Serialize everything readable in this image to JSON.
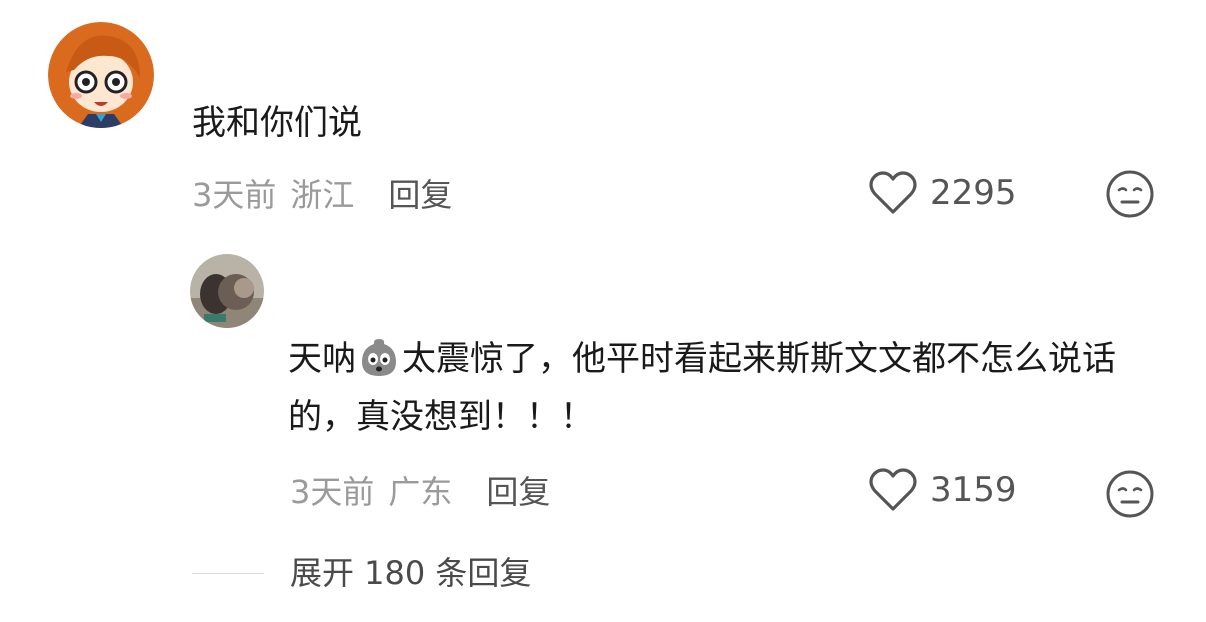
{
  "comments": [
    {
      "text": "我和你们说",
      "time": "3天前",
      "location": "浙江",
      "reply_label": "回复",
      "likes": "2295"
    },
    {
      "text_before_emoji": "天呐",
      "inline_emoji": "scared-face-emoji",
      "text_after_emoji": "太震惊了，他平时看起来斯斯文文都不怎么说话的，真没想到！！！",
      "time": "3天前",
      "location": "广东",
      "reply_label": "回复",
      "likes": "3159"
    }
  ],
  "expand_replies": "展开 180 条回复",
  "icons": {
    "like": "heart-outline-icon",
    "dislike": "neutral-face-icon"
  },
  "colors": {
    "meta_gray": "#9a9a9a",
    "reply_gray": "#555555",
    "text": "#1a1a1a"
  }
}
